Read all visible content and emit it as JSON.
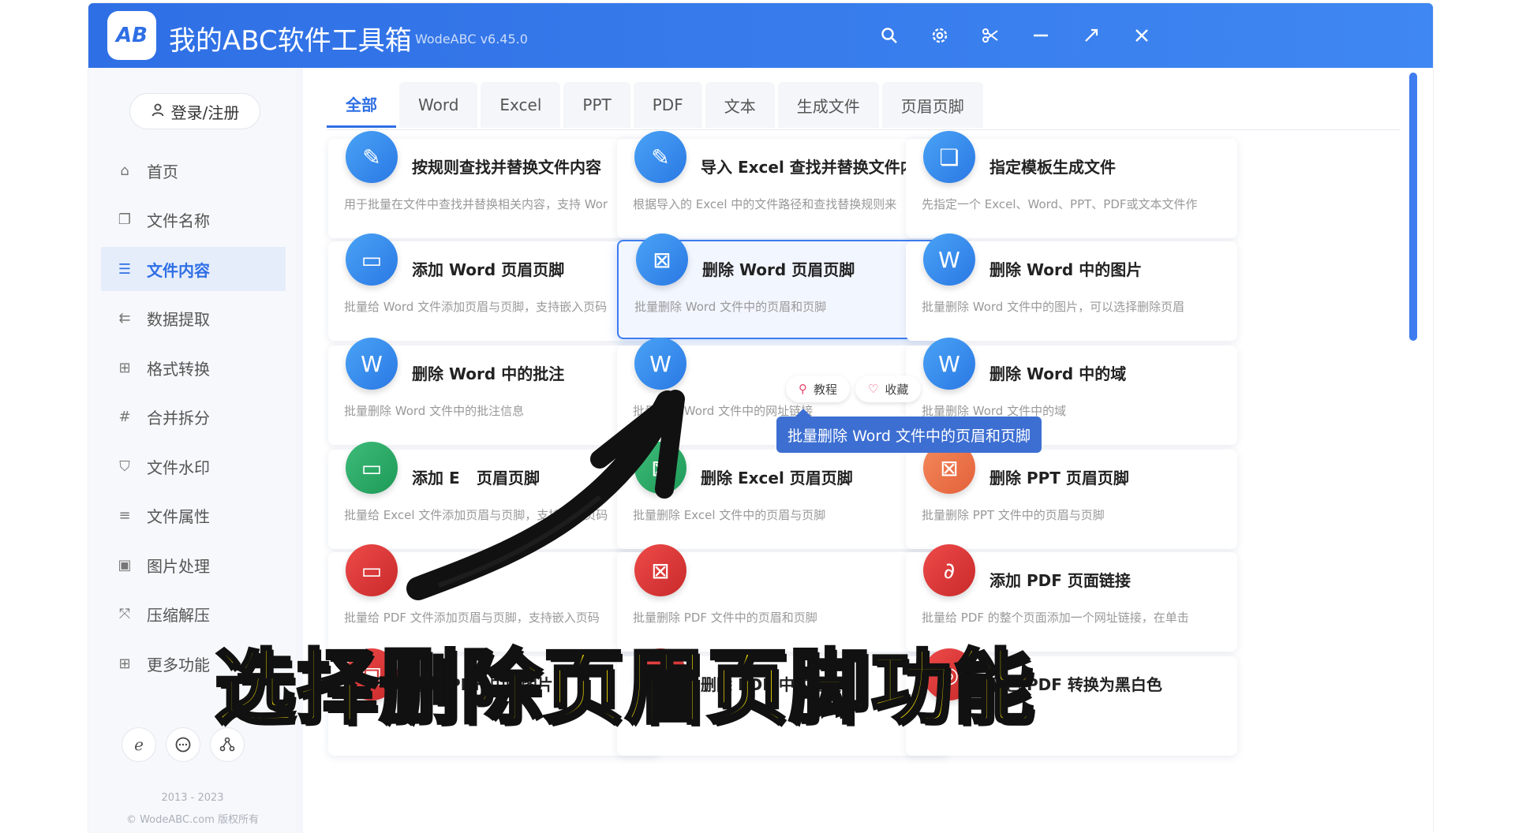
{
  "app": {
    "title": "我的ABC软件工具箱",
    "version": "WodeABC v6.45.0",
    "logo": "AB"
  },
  "titlebar_icons": [
    "search-icon",
    "gear-icon",
    "scissors-icon",
    "minimize-icon",
    "expand-icon",
    "close-icon"
  ],
  "sidebar": {
    "login_label": "登录/注册",
    "items": [
      {
        "label": "首页",
        "icon": "⌂",
        "active": false
      },
      {
        "label": "文件名称",
        "icon": "❐",
        "active": false
      },
      {
        "label": "文件内容",
        "icon": "☰",
        "active": true
      },
      {
        "label": "数据提取",
        "icon": "⇇",
        "active": false
      },
      {
        "label": "格式转换",
        "icon": "⊞",
        "active": false
      },
      {
        "label": "合并拆分",
        "icon": "#",
        "active": false
      },
      {
        "label": "文件水印",
        "icon": "⛉",
        "active": false
      },
      {
        "label": "文件属性",
        "icon": "≡",
        "active": false
      },
      {
        "label": "图片处理",
        "icon": "▣",
        "active": false
      },
      {
        "label": "压缩解压",
        "icon": "⤧",
        "active": false
      },
      {
        "label": "更多功能",
        "icon": "⊞",
        "active": false
      }
    ],
    "copyright_years": "2013 - 2023",
    "copyright_text": "© WodeABC.com 版权所有"
  },
  "tabs": [
    "全部",
    "Word",
    "Excel",
    "PPT",
    "PDF",
    "文本",
    "生成文件",
    "页眉页脚"
  ],
  "cards": [
    {
      "title": "按规则查找并替换文件内容",
      "desc": "用于批量在文件中查找并替换相关内容，支持 Wor",
      "color": "blue",
      "glyph": "✎"
    },
    {
      "title": "导入 Excel 查找并替换文件内容",
      "desc": "根据导入的 Excel 中的文件路径和查找替换规则来",
      "color": "blue",
      "glyph": "✎"
    },
    {
      "title": "指定模板生成文件",
      "desc": "先指定一个 Excel、Word、PPT、PDF或文本文件作",
      "color": "blue",
      "glyph": "❏"
    },
    {
      "title": "添加 Word 页眉页脚",
      "desc": "批量给 Word 文件添加页眉与页脚，支持嵌入页码",
      "color": "blue",
      "glyph": "▭"
    },
    {
      "title": "删除 Word 页眉页脚",
      "desc": "批量删除 Word 文件中的页眉和页脚",
      "color": "blue",
      "glyph": "⊠"
    },
    {
      "title": "删除 Word 中的图片",
      "desc": "批量删除 Word 文件中的图片，可以选择删除页眉",
      "color": "blue",
      "glyph": "W"
    },
    {
      "title": "删除 Word 中的批注",
      "desc": "批量删除 Word 文件中的批注信息",
      "color": "blue",
      "glyph": "W"
    },
    {
      "title": "",
      "desc": "批量删除 Word 文件中的网址链接",
      "color": "blue",
      "glyph": "W"
    },
    {
      "title": "删除 Word 中的域",
      "desc": "批量删除 Word 文件中的域",
      "color": "blue",
      "glyph": "W"
    },
    {
      "title": "添加 E",
      "title_tail": "页眉页脚",
      "desc": "批量给 Excel 文件添加页眉与页脚，支持嵌入页码",
      "color": "green",
      "glyph": "▭"
    },
    {
      "title": "删除 Excel 页眉页脚",
      "desc": "批量删除 Excel 文件中的页眉与页脚",
      "color": "green",
      "glyph": "⊠"
    },
    {
      "title": "删除 PPT 页眉页脚",
      "desc": "批量删除 PPT 文件中的页眉与页脚",
      "color": "orange",
      "glyph": "⊠"
    },
    {
      "title": "",
      "desc": "批量给 PDF 文件添加页眉与页脚，支持嵌入页码",
      "color": "red",
      "glyph": "▭"
    },
    {
      "title": "",
      "desc": "批量删除 PDF 文件中的页眉和页脚",
      "color": "red",
      "glyph": "⊠"
    },
    {
      "title": "添加 PDF 页面链接",
      "desc": "批量给 PDF 的整个页面添加一个网址链接，在单击",
      "color": "red",
      "glyph": "∂"
    },
    {
      "title": "删除 PDF 中的图片",
      "desc": "",
      "color": "red",
      "glyph": "▣"
    },
    {
      "title": "删除 PDF 中的链接",
      "desc": "",
      "color": "red",
      "glyph": "∂"
    },
    {
      "title": "彩色 PDF 转换为黑白色",
      "desc": "",
      "color": "red",
      "glyph": "◎"
    }
  ],
  "hover_actions": {
    "tutorial": "教程",
    "favorite": "收藏"
  },
  "tooltip": "批量删除 Word 文件中的页眉和页脚",
  "overlay_caption": "选择删除页眉页脚功能",
  "footer_icons": [
    "browser-icon",
    "chat-icon",
    "share-icon"
  ]
}
